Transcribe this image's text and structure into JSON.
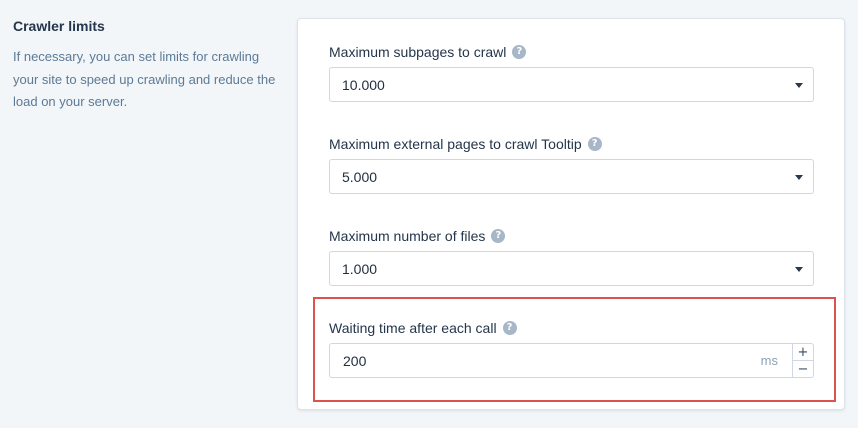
{
  "section": {
    "title": "Crawler limits",
    "description": "If necessary, you can set limits for crawling your site to speed up crawling and reduce the load on your server."
  },
  "fields": {
    "max_subpages": {
      "label": "Maximum subpages to crawl",
      "value": "10.000",
      "help_icon": "question-circle-icon"
    },
    "max_external": {
      "label": "Maximum external pages to crawl Tooltip",
      "value": "5.000",
      "help_icon": "question-circle-icon"
    },
    "max_files": {
      "label": "Maximum number of files",
      "value": "1.000",
      "help_icon": "question-circle-icon"
    },
    "waiting_time": {
      "label": "Waiting time after each call",
      "value": "200",
      "unit": "ms",
      "increment": "+",
      "decrement": "−",
      "help_icon": "question-circle-icon"
    }
  },
  "help_glyph": "?",
  "colors": {
    "highlight": "#d9534f",
    "help_icon": "#a7b7c7",
    "description_text": "#5c7a96"
  }
}
